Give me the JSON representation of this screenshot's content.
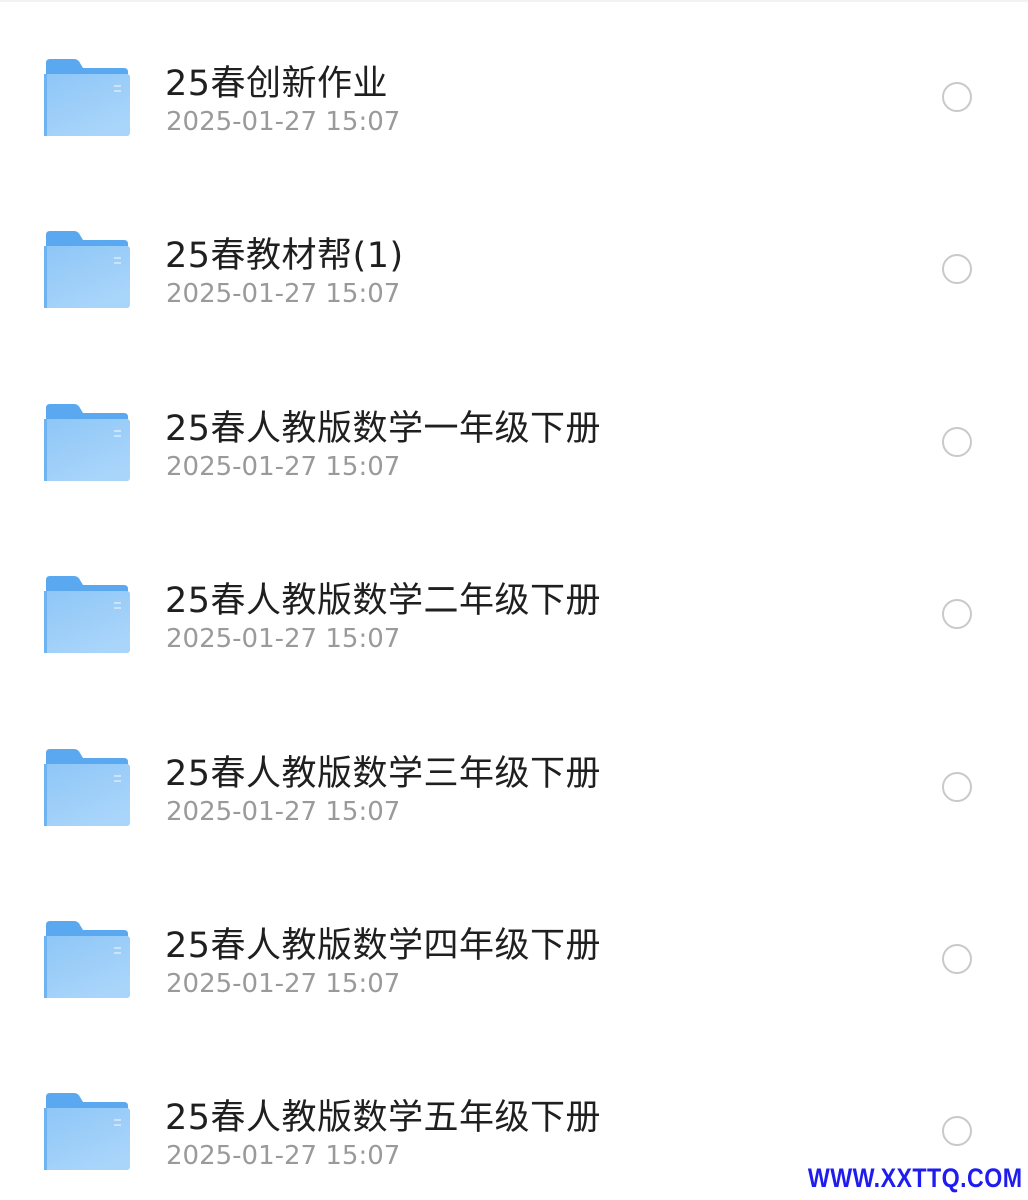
{
  "files": [
    {
      "name": "25春创新作业",
      "modified": "2025-01-27 15:07",
      "icon": "folder-icon"
    },
    {
      "name": "25春教材帮(1)",
      "modified": "2025-01-27 15:07",
      "icon": "folder-icon"
    },
    {
      "name": "25春人教版数学一年级下册",
      "modified": "2025-01-27 15:07",
      "icon": "folder-icon"
    },
    {
      "name": "25春人教版数学二年级下册",
      "modified": "2025-01-27 15:07",
      "icon": "folder-icon"
    },
    {
      "name": "25春人教版数学三年级下册",
      "modified": "2025-01-27 15:07",
      "icon": "folder-icon"
    },
    {
      "name": "25春人教版数学四年级下册",
      "modified": "2025-01-27 15:07",
      "icon": "folder-icon"
    },
    {
      "name": "25春人教版数学五年级下册",
      "modified": "2025-01-27 15:07",
      "icon": "folder-icon"
    }
  ],
  "watermark": "WWW.XXTTQ.COM",
  "colors": {
    "folder_back": "#5aa8ef",
    "folder_front_top": "#8ec6f7",
    "folder_front_bottom": "#a9d5fa",
    "title_text": "#1f1f1f",
    "date_text": "#9a9a9a",
    "radio_border": "#c9c9c9",
    "watermark": "#1f1cf0"
  }
}
